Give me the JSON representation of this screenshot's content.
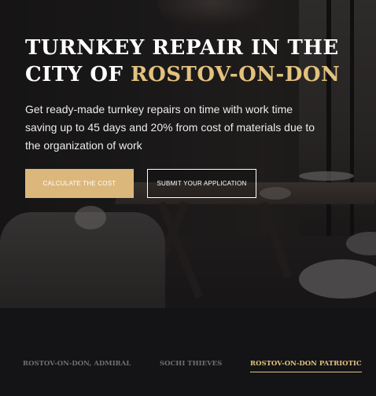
{
  "hero": {
    "title_line1": "TURNKEY REPAIR IN THE",
    "title_line2_prefix": "CITY OF ",
    "title_line2_accent": "ROSTOV-ON-DON",
    "description": "Get ready-made turnkey repairs on time with work time saving up to 45 days and 20% from cost of materials due to the organization of work",
    "buttons": {
      "calculate": "CALCULATE THE COST",
      "submit": "SUBMIT YOUR APPLICATION"
    }
  },
  "tabs": [
    {
      "label": "ROSTOV-ON-DON, ADMIRAL",
      "active": false
    },
    {
      "label": "SOCHI THIEVES",
      "active": false
    },
    {
      "label": "ROSTOV-ON-DON PATRIOTIC",
      "active": true
    }
  ],
  "colors": {
    "accent": "#e3c27e",
    "button_primary": "#dcb77c",
    "background_dark": "#141416"
  }
}
